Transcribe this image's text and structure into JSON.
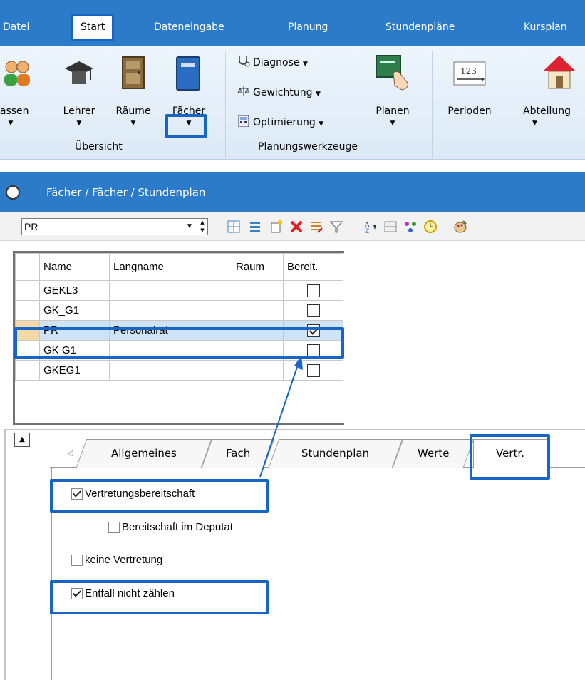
{
  "ribbon_tabs": [
    "Datei",
    "Start",
    "Dateneingabe",
    "Planung",
    "Stundenpläne",
    "Kursplan"
  ],
  "ribbon": {
    "buttons": {
      "klassen": "lassen",
      "lehrer": "Lehrer",
      "raeume": "Räume",
      "faecher": "Fächer",
      "planen": "Planen",
      "perioden": "Perioden",
      "abteilung": "Abteilung"
    },
    "tools": {
      "diagnose": "Diagnose",
      "gewichtung": "Gewichtung",
      "optimierung": "Optimierung"
    },
    "groups": {
      "uebersicht": "Übersicht",
      "planungswerkzeuge": "Planungswerkzeuge"
    },
    "perioden_icon_text": "123"
  },
  "window_title": "Fächer / Fächer / Stundenplan",
  "toolbar": {
    "combo_value": "PR"
  },
  "grid": {
    "headers": [
      "Name",
      "Langname",
      "Raum",
      "Bereit."
    ],
    "rows": [
      {
        "name": "GEKL3",
        "langname": "",
        "raum": "",
        "bereit": false
      },
      {
        "name": "GK_G1",
        "langname": "",
        "raum": "",
        "bereit": false
      },
      {
        "name": "PR",
        "langname": "Personalrat",
        "raum": "",
        "bereit": true
      },
      {
        "name": "GK G1",
        "langname": "",
        "raum": "",
        "bereit": false
      },
      {
        "name": "GKEG1",
        "langname": "",
        "raum": "",
        "bereit": false
      }
    ]
  },
  "detail_tabs": [
    "Allgemeines",
    "Fach",
    "Stundenplan",
    "Werte",
    "Vertr."
  ],
  "options": {
    "vertretungsbereitschaft": {
      "label": "Vertretungsbereitschaft",
      "checked": true
    },
    "bereitschaft_im_deputat": {
      "label": "Bereitschaft im Deputat",
      "checked": false
    },
    "keine_vertretung": {
      "label": "keine Vertretung",
      "checked": false
    },
    "entfall_nicht_zaehlen": {
      "label": "Entfall nicht zählen",
      "checked": true
    }
  },
  "colors": {
    "accent": "#2b7bc8",
    "highlight": "#1765c5",
    "selection": "#cfe3f6"
  }
}
